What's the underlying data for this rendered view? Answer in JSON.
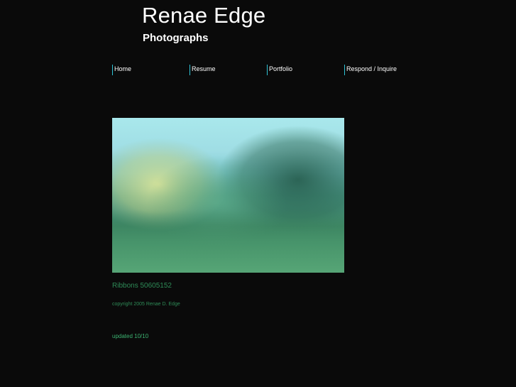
{
  "header": {
    "title": "Renae Edge",
    "subtitle": "Photographs"
  },
  "nav": {
    "items": [
      {
        "label": "Home"
      },
      {
        "label": "Resume"
      },
      {
        "label": "Portfolio"
      },
      {
        "label": "Respond / Inquire"
      }
    ]
  },
  "photo": {
    "alt": "Ribbons 50605152"
  },
  "caption": {
    "text": "Ribbons 50605152"
  },
  "footer": {
    "copyright": "copyright 2005 Renae  D.  Edge",
    "updated": "updated 10/10"
  },
  "colors": {
    "background": "#0a0a0a",
    "nav_accent": "#2ec4d6",
    "caption_text": "#2e8b57",
    "footer_text": "#2e8b57",
    "updated_text": "#3cb371"
  }
}
